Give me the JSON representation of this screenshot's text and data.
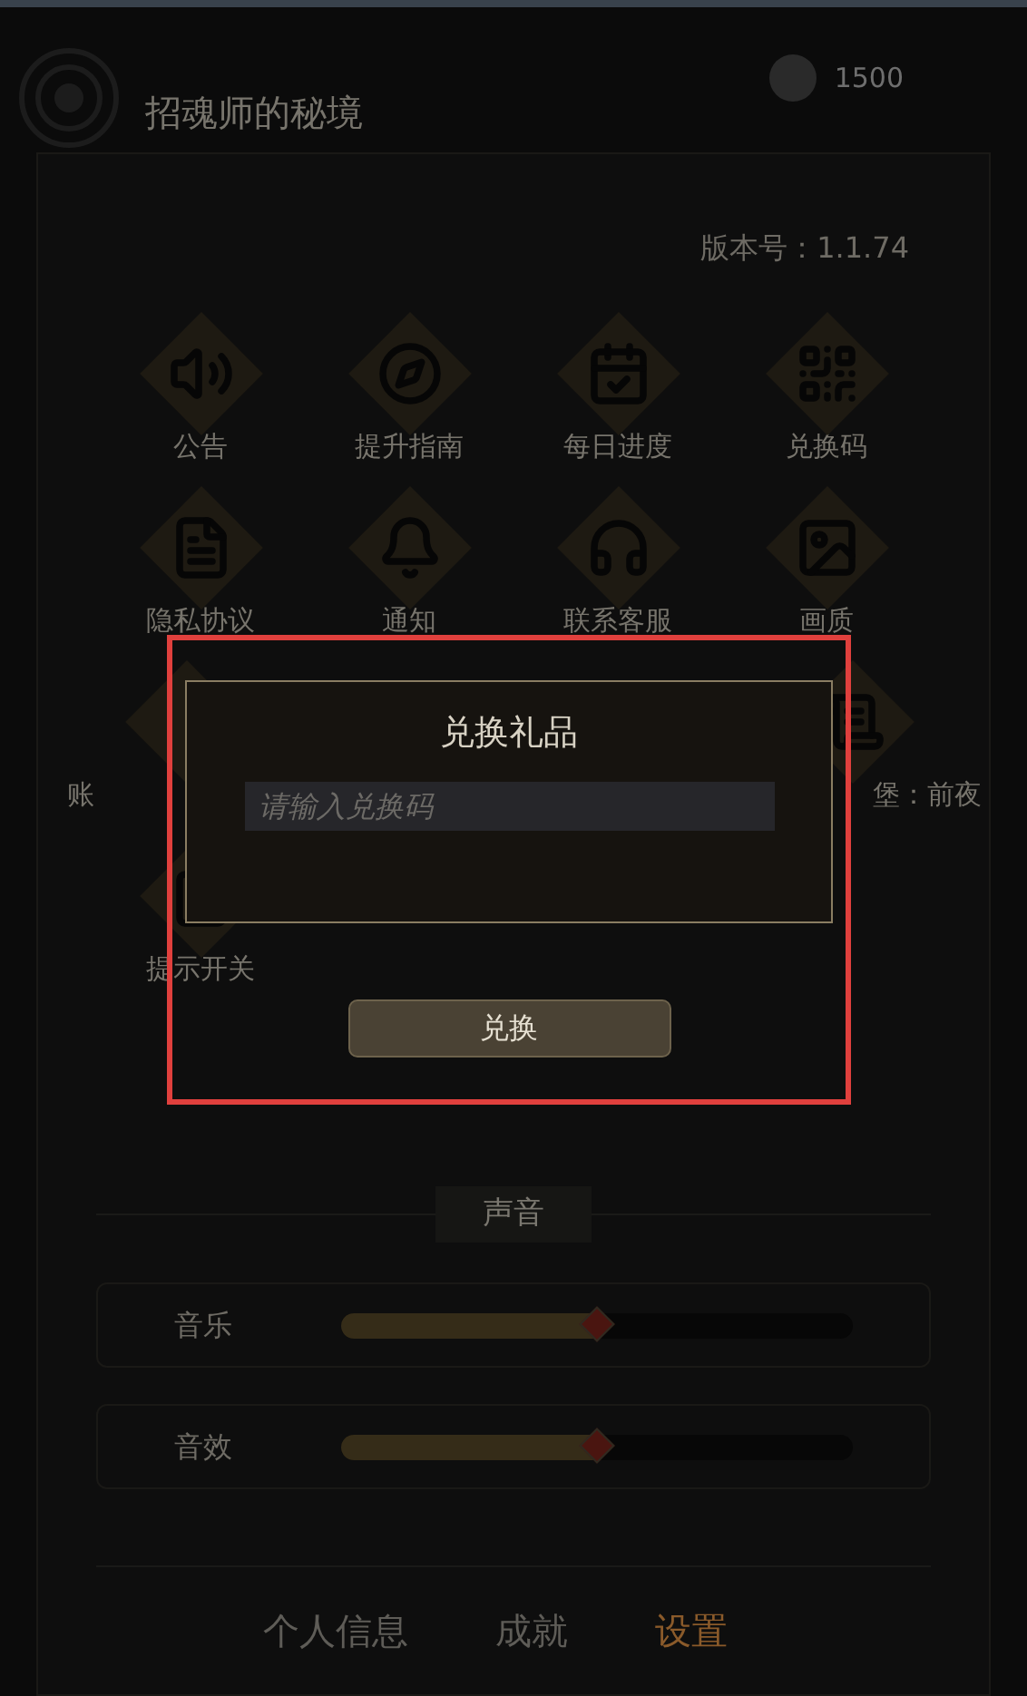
{
  "header": {
    "title": "招魂师的秘境",
    "coins": "1500"
  },
  "version": "版本号：1.1.74",
  "menu": [
    {
      "label": "公告"
    },
    {
      "label": "提升指南"
    },
    {
      "label": "每日进度"
    },
    {
      "label": "兑换码"
    },
    {
      "label": "隐私协议"
    },
    {
      "label": "通知"
    },
    {
      "label": "联系客服"
    },
    {
      "label": "画质"
    },
    {
      "label": "账"
    },
    {
      "label": "堡：前夜"
    },
    {
      "label": "提示开关"
    }
  ],
  "sound": {
    "title": "声音",
    "sliders": [
      {
        "label": "音乐",
        "level": 0.5
      },
      {
        "label": "音效",
        "level": 0.5
      }
    ]
  },
  "tabs": [
    {
      "label": "个人信息",
      "selected": false
    },
    {
      "label": "成就",
      "selected": false
    },
    {
      "label": "设置",
      "selected": true
    }
  ],
  "dialog": {
    "title": "兑换礼品",
    "placeholder": "请输入兑换码",
    "button": "兑换"
  }
}
